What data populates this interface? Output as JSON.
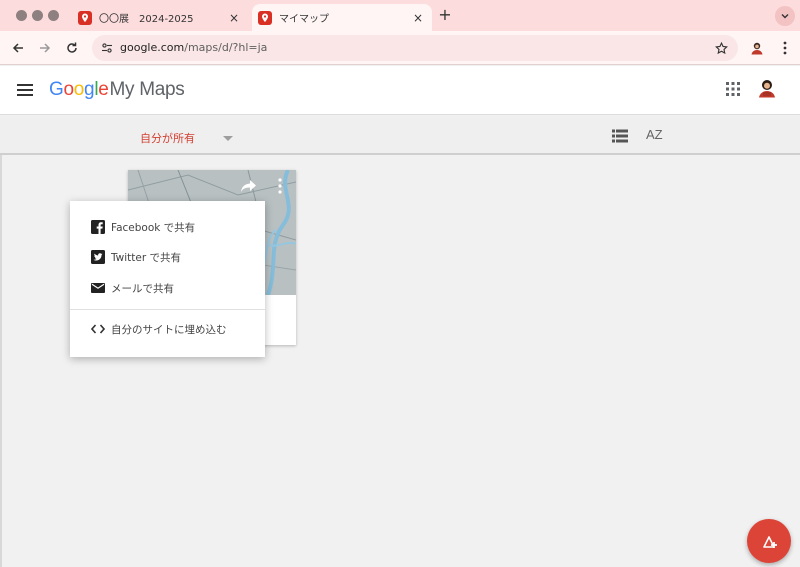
{
  "browser": {
    "tabs": [
      {
        "title": "〇〇展　2024-2025",
        "close": "×"
      },
      {
        "title": "マイマップ",
        "close": "×"
      }
    ],
    "new_tab": "+",
    "url_host": "google.com",
    "url_path": "/maps/d/?hl=ja"
  },
  "header": {
    "logo_letters": [
      "G",
      "o",
      "o",
      "g",
      "l",
      "e"
    ],
    "product": "My Maps"
  },
  "filter": {
    "owner_label": "自分が所有",
    "sort_label": "AZ"
  },
  "share_menu": {
    "items": [
      {
        "label": "Facebook で共有",
        "icon": "facebook-icon"
      },
      {
        "label": "Twitter で共有",
        "icon": "twitter-icon"
      },
      {
        "label": "メールで共有",
        "icon": "email-icon"
      },
      {
        "label": "自分のサイトに埋め込む",
        "icon": "embed-code-icon"
      }
    ]
  },
  "colors": {
    "accent_red": "#db4437",
    "filter_red": "#d23f31",
    "tabbar": "#fcdcdc"
  }
}
